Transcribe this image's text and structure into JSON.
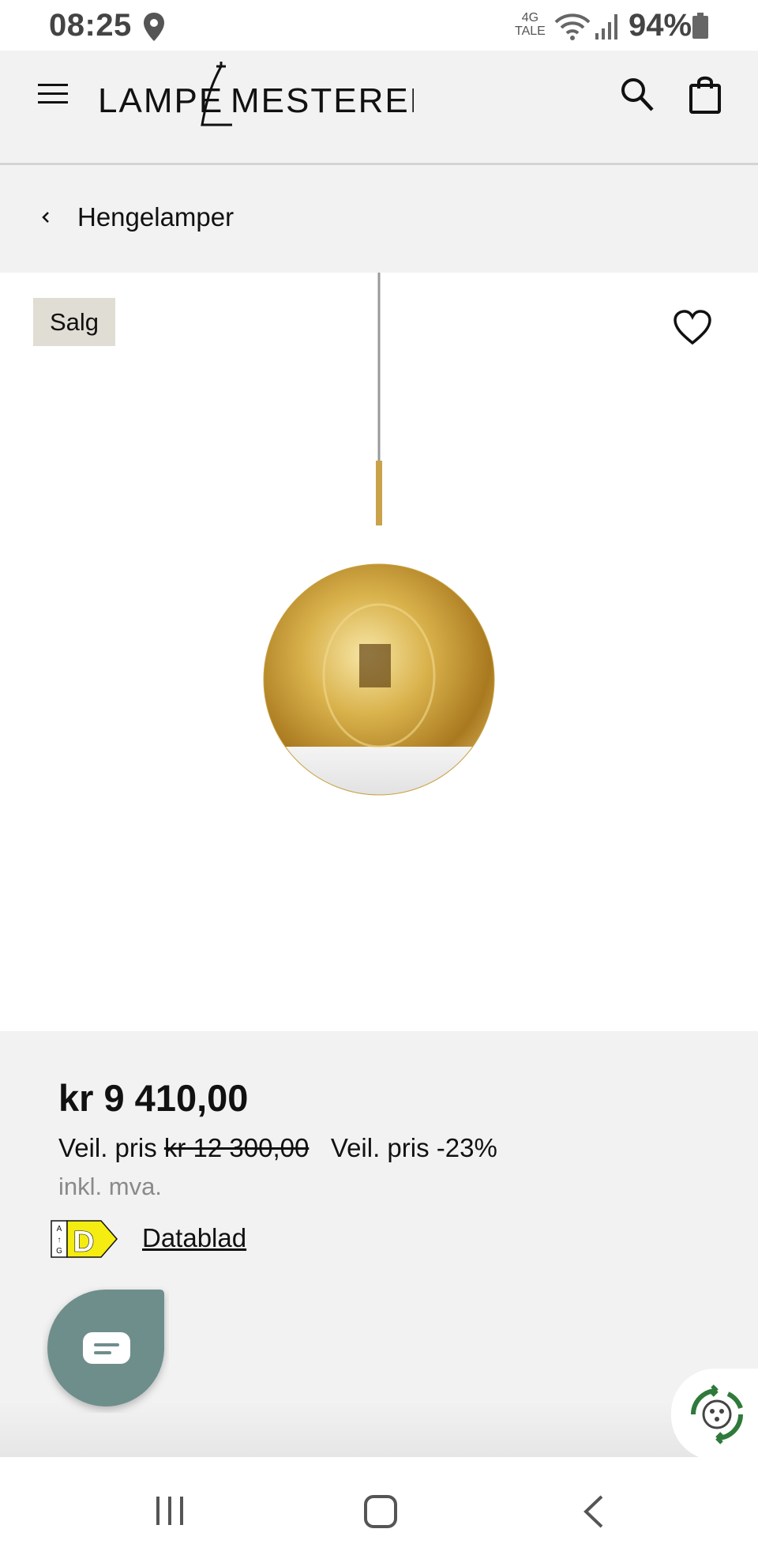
{
  "status_bar": {
    "time": "08:25",
    "network_top": "4G",
    "network_bottom": "TALE",
    "battery": "94%"
  },
  "header": {
    "logo_text": "LAMPE MESTEREN",
    "icons": [
      "menu-icon",
      "search-icon",
      "cart-icon"
    ]
  },
  "breadcrumb": {
    "label": "Hengelamper"
  },
  "product": {
    "badge": "Salg",
    "price": "kr 9 410,00",
    "recommended_label": "Veil. pris",
    "old_price": "kr 12 300,00",
    "discount_label": "Veil. pris -23%",
    "vat_note": "inkl. mva.",
    "energy_class": "D",
    "energy_scale_top": "A",
    "energy_scale_bottom": "G",
    "datasheet_label": "Datablad"
  },
  "colors": {
    "background": "#f2f2f2",
    "badge": "#e0ddd4",
    "chat": "#6e8e8c",
    "energy_yellow": "#f5ec12",
    "recycle_green": "#2f7a3a"
  },
  "navbar": {
    "icons": [
      "recent-apps-icon",
      "home-icon",
      "back-icon"
    ]
  }
}
